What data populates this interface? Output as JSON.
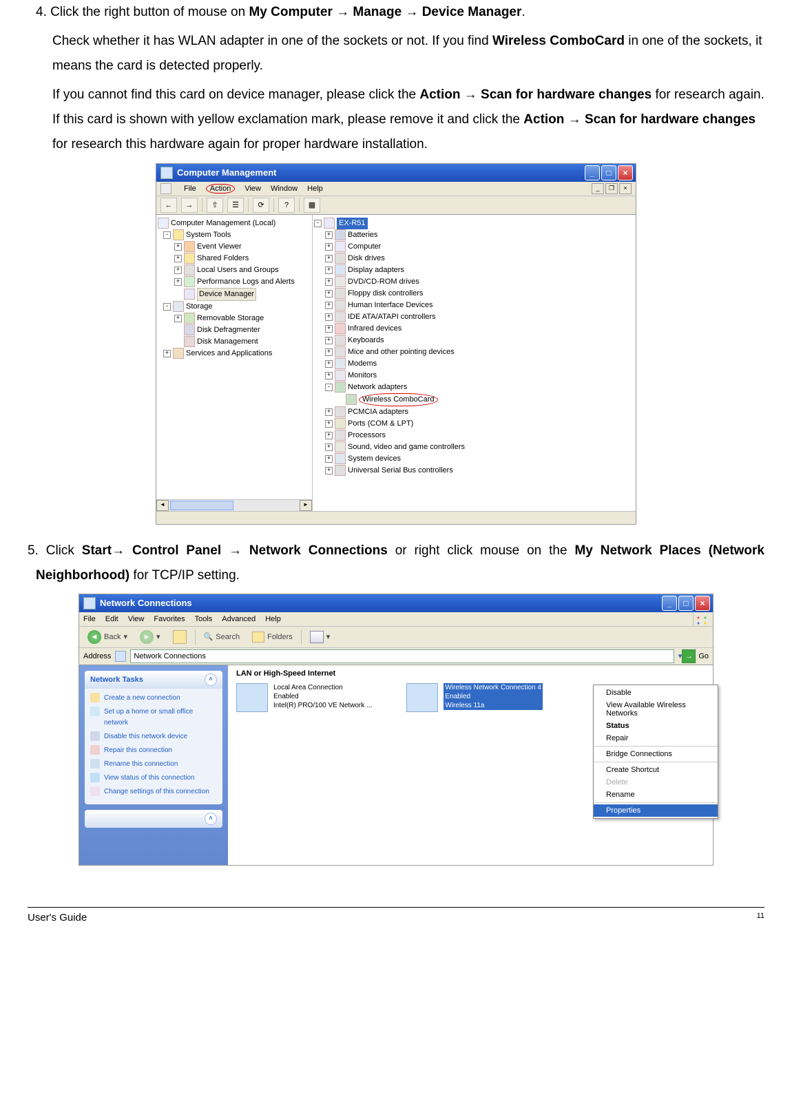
{
  "step4": {
    "line1_prefix": "4. Click the right button of mouse on ",
    "bold1": "My Computer → Manage → Device Manager",
    "line1_suffix": ".",
    "line2_a": "Check whether it has WLAN adapter in one of the sockets or not.  If you find ",
    "bold2": "Wireless ComboCard",
    "line2_b": " in one of the sockets, it means the card is detected properly.",
    "line3_a": "If you cannot find this card on device manager, please click the ",
    "bold3": "Action → Scan for hardware changes",
    "line3_b": " for research again. If this card is shown with yellow exclamation mark, please remove it and click the ",
    "bold4": "Action → Scan for hardware changes",
    "line3_c": " for research this hardware again for proper hardware installation."
  },
  "ss1": {
    "title": "Computer Management",
    "menu": {
      "file": "File",
      "action": "Action",
      "view": "View",
      "window": "Window",
      "help": "Help"
    },
    "mdi": {
      "min": "_",
      "restore": "❐",
      "close": "×"
    },
    "toolbar": {
      "back": "←",
      "fwd": "→",
      "up": "⇧",
      "props": "☰",
      "refresh": "⟳",
      "help": "?",
      "mon": "▦"
    },
    "left": {
      "root": "Computer Management (Local)",
      "systools": "System Tools",
      "eventviewer": "Event Viewer",
      "sharedfolders": "Shared Folders",
      "localusers": "Local Users and Groups",
      "perflogs": "Performance Logs and Alerts",
      "devmgr": "Device Manager",
      "storage": "Storage",
      "removable": "Removable Storage",
      "defrag": "Disk Defragmenter",
      "diskmgmt": "Disk Management",
      "services": "Services and Applications"
    },
    "right": {
      "root": "EX-R51",
      "nodes": {
        "batteries": "Batteries",
        "computer": "Computer",
        "diskdrives": "Disk drives",
        "display": "Display adapters",
        "dvd": "DVD/CD-ROM drives",
        "floppy": "Floppy disk controllers",
        "hid": "Human Interface Devices",
        "ide": "IDE ATA/ATAPI controllers",
        "infrared": "Infrared devices",
        "keyboards": "Keyboards",
        "mice": "Mice and other pointing devices",
        "modems": "Modems",
        "monitors": "Monitors",
        "network": "Network adapters",
        "wireless": "Wireless  ComboCard",
        "pcmcia": "PCMCIA adapters",
        "ports": "Ports (COM & LPT)",
        "processors": "Processors",
        "sound": "Sound, video and game controllers",
        "sysdev": "System devices",
        "usb": "Universal Serial Bus controllers"
      }
    }
  },
  "step5": {
    "a": "5. Click ",
    "bold1": "Start→ Control Panel → Network Connections",
    "b": " or right click mouse on the ",
    "bold2": "My Network Places (Network Neighborhood)",
    "c": " for TCP/IP setting."
  },
  "ss2": {
    "title": "Network Connections",
    "menu": {
      "file": "File",
      "edit": "Edit",
      "view": "View",
      "favorites": "Favorites",
      "tools": "Tools",
      "advanced": "Advanced",
      "help": "Help"
    },
    "toolbar": {
      "back": "Back",
      "search": "Search",
      "folders": "Folders"
    },
    "addr": {
      "label": "Address",
      "value": "Network Connections",
      "go": "Go"
    },
    "side": {
      "head": "Network Tasks",
      "t1": "Create a new connection",
      "t2": "Set up a home or small office network",
      "t3": "Disable this network device",
      "t4": "Repair this connection",
      "t5": "Rename this connection",
      "t6": "View status of this connection",
      "t7": "Change settings of this connection"
    },
    "cat": "LAN or High-Speed Internet",
    "conn1": {
      "name": "Local Area Connection",
      "status": "Enabled",
      "dev": "Intel(R) PRO/100 VE Network ..."
    },
    "conn2": {
      "name": "Wireless Network Connection 4",
      "status": "Enabled",
      "dev": "Wireless 11a"
    },
    "ctx": {
      "disable": "Disable",
      "view": "View Available Wireless Networks",
      "status": "Status",
      "repair": "Repair",
      "bridge": "Bridge Connections",
      "shortcut": "Create Shortcut",
      "delete": "Delete",
      "rename": "Rename",
      "props": "Properties"
    }
  },
  "footer": {
    "guide": "User's Guide",
    "page": "11"
  }
}
